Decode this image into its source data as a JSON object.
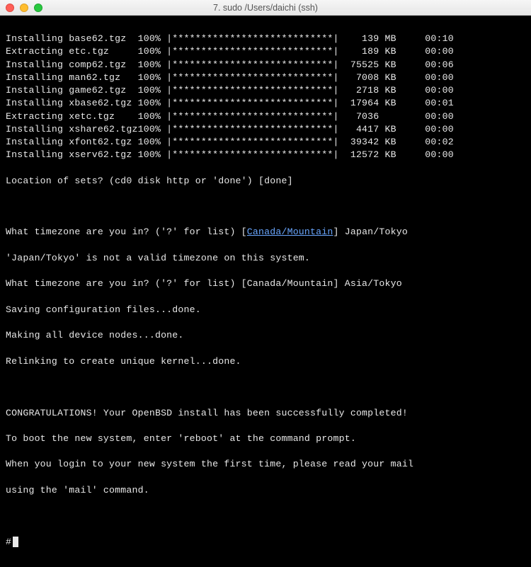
{
  "window": {
    "title": "7. sudo  /Users/daichi (ssh)"
  },
  "install_rows": [
    {
      "action": "Installing",
      "file": "base62.tgz",
      "pct": "100%",
      "size": "139",
      "unit": "MB",
      "time": "00:10"
    },
    {
      "action": "Extracting",
      "file": "etc.tgz",
      "pct": "100%",
      "size": "189",
      "unit": "KB",
      "time": "00:00"
    },
    {
      "action": "Installing",
      "file": "comp62.tgz",
      "pct": "100%",
      "size": "75525",
      "unit": "KB",
      "time": "00:06"
    },
    {
      "action": "Installing",
      "file": "man62.tgz",
      "pct": "100%",
      "size": "7008",
      "unit": "KB",
      "time": "00:00"
    },
    {
      "action": "Installing",
      "file": "game62.tgz",
      "pct": "100%",
      "size": "2718",
      "unit": "KB",
      "time": "00:00"
    },
    {
      "action": "Installing",
      "file": "xbase62.tgz",
      "pct": "100%",
      "size": "17964",
      "unit": "KB",
      "time": "00:01"
    },
    {
      "action": "Extracting",
      "file": "xetc.tgz",
      "pct": "100%",
      "size": "7036",
      "unit": "",
      "time": "00:00"
    },
    {
      "action": "Installing",
      "file": "xshare62.tgz",
      "pct": "100%",
      "size": "4417",
      "unit": "KB",
      "time": "00:00"
    },
    {
      "action": "Installing",
      "file": "xfont62.tgz",
      "pct": "100%",
      "size": "39342",
      "unit": "KB",
      "time": "00:02"
    },
    {
      "action": "Installing",
      "file": "xserv62.tgz",
      "pct": "100%",
      "size": "12572",
      "unit": "KB",
      "time": "00:00"
    }
  ],
  "location_prompt": "Location of sets? (cd0 disk http or 'done') [done]",
  "tz1_prefix": "What timezone are you in? ('?' for list) [",
  "tz1_link": "Canada/Mountain",
  "tz1_suffix": "] Japan/Tokyo",
  "tz_error": "'Japan/Tokyo' is not a valid timezone on this system.",
  "tz2_line": "What timezone are you in? ('?' for list) [Canada/Mountain] Asia/Tokyo",
  "saving": "Saving configuration files...done.",
  "nodes": "Making all device nodes...done.",
  "relink": "Relinking to create unique kernel...done.",
  "congrats": "CONGRATULATIONS! Your OpenBSD install has been successfully completed!",
  "boot": "To boot the new system, enter 'reboot' at the command prompt.",
  "login": "When you login to your new system the first time, please read your mail",
  "mail": "using the 'mail' command.",
  "prompt": "#"
}
